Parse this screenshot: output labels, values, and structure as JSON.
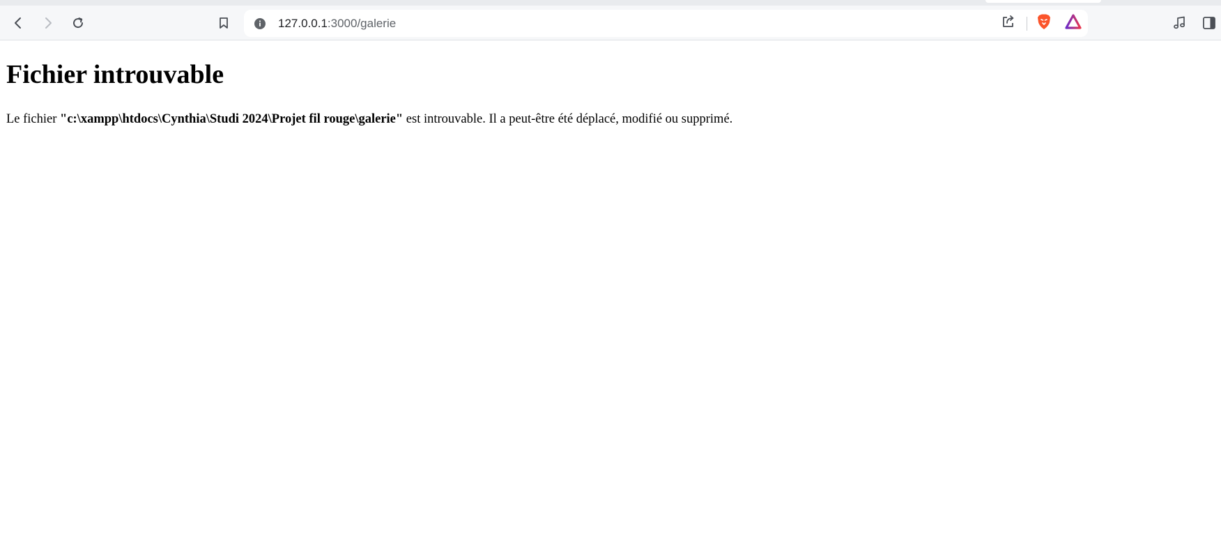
{
  "browser": {
    "url_host": "127.0.0.1",
    "url_path": ":3000/galerie",
    "icons": {
      "back": "back-arrow-icon",
      "forward": "forward-arrow-icon",
      "reload": "reload-icon",
      "bookmark": "bookmark-icon",
      "site_info": "info-icon",
      "share": "share-icon",
      "brave_shields": "brave-lion-icon",
      "rewards": "brave-rewards-triangle-icon",
      "media": "music-note-icon",
      "sidebar": "sidebar-panel-icon"
    },
    "colors": {
      "toolbar_bg": "#f6f7f9",
      "omnibox_bg": "#ffffff",
      "brave_orange": "#fb542b",
      "rewards_purple": "#6b2bc8",
      "rewards_red": "#e8364f"
    }
  },
  "page": {
    "title": "Fichier introuvable",
    "message_prefix": "Le fichier ",
    "file_path": "\"c:\\xampp\\htdocs\\Cynthia\\Studi 2024\\Projet fil rouge\\galerie\"",
    "message_suffix": " est introuvable. Il a peut-être été déplacé, modifié ou supprimé."
  }
}
